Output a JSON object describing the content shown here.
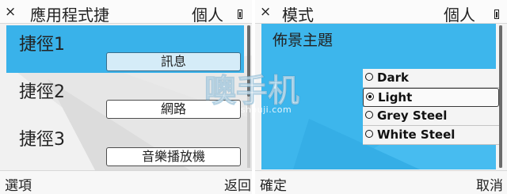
{
  "left_screen": {
    "status": {
      "close": "×",
      "title": "應用程式捷",
      "user": "個人"
    },
    "shortcuts": [
      {
        "label": "捷徑1",
        "action": "訊息",
        "selected": true
      },
      {
        "label": "捷徑2",
        "action": "網路",
        "selected": false
      },
      {
        "label": "捷徑3",
        "action": "音樂播放機",
        "selected": false
      }
    ],
    "softkeys": {
      "left": "選項",
      "right": "返回"
    }
  },
  "right_screen": {
    "status": {
      "close": "×",
      "title": "模式",
      "user": "個人"
    },
    "heading": "佈景主題",
    "themes": [
      {
        "label": "Dark",
        "selected": false
      },
      {
        "label": "Light",
        "selected": true
      },
      {
        "label": "Grey Steel",
        "selected": false
      },
      {
        "label": "White Steel",
        "selected": false
      }
    ],
    "softkeys": {
      "left": "確定",
      "right": "取消"
    }
  },
  "watermark": {
    "url": "www.oshouji.com"
  },
  "colors": {
    "highlight": "#39b2ea",
    "selected_button": "#d5ecf8"
  },
  "icons": [
    "close-icon",
    "battery-icon",
    "radio-icon"
  ]
}
